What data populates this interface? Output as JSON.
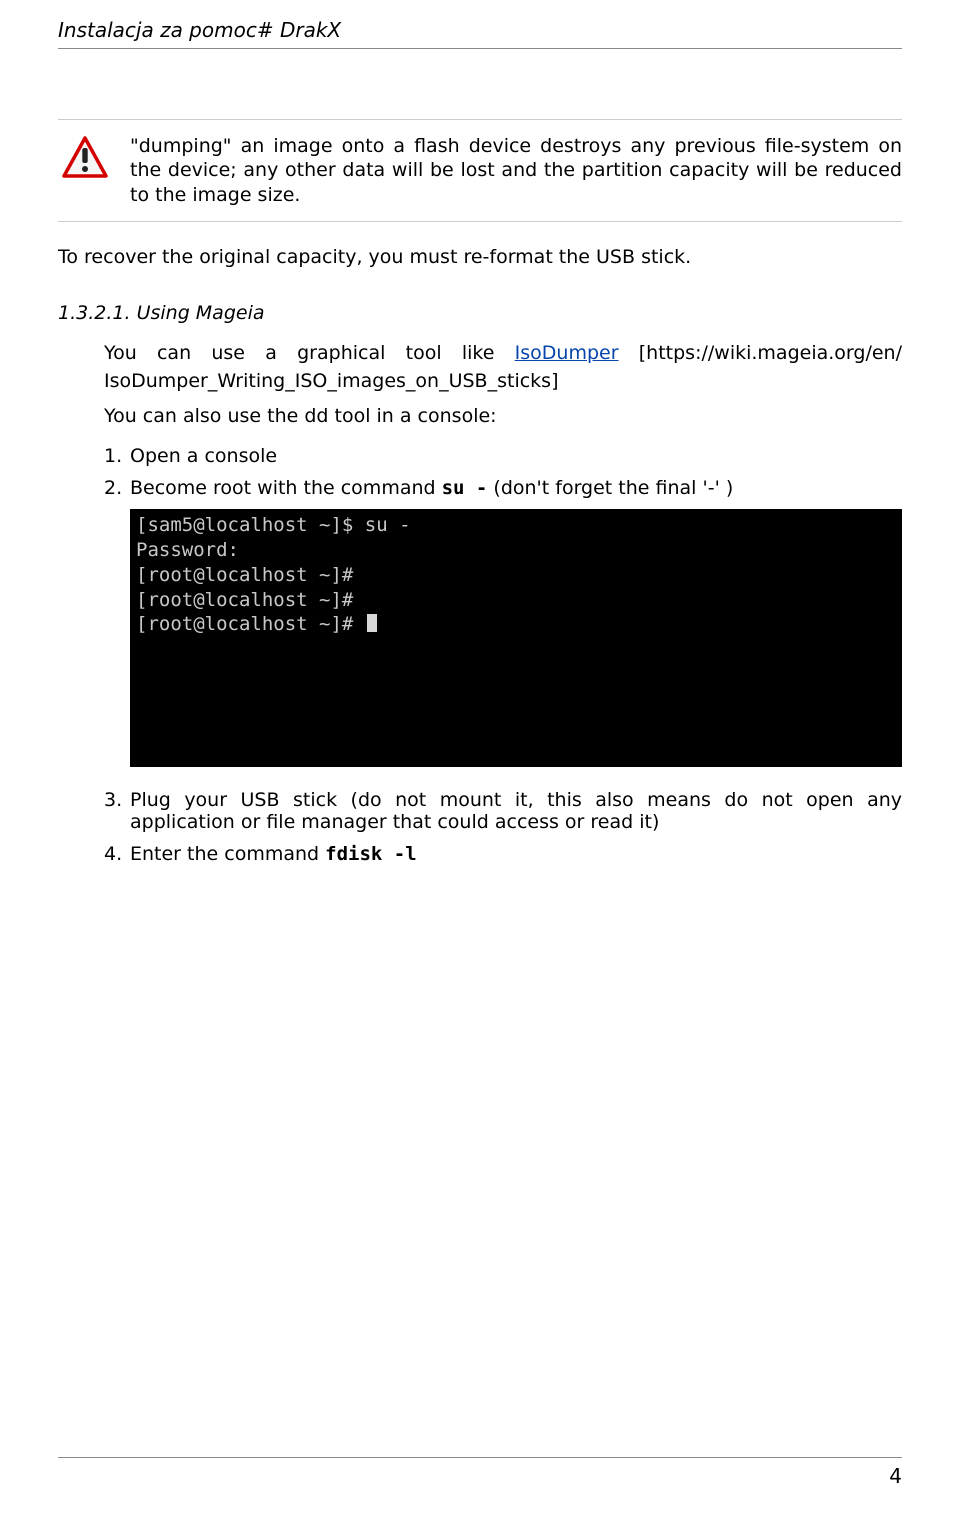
{
  "header": {
    "title": "Instalacja za pomoc# DrakX"
  },
  "warning": {
    "text": "\"dumping\" an image onto a flash device destroys any previous file-system on the device; any other data will be lost and the partition capacity will be reduced to the image size."
  },
  "recover": "To recover the original capacity, you must re-format the USB stick.",
  "section": {
    "num": "1.3.2.1.",
    "title": "Using Mageia"
  },
  "graphical": {
    "part1a": "You",
    "part1b": "can",
    "part1c": "use",
    "part1d": "a",
    "part1e": "graphical",
    "part1f": "tool",
    "part1g": "like",
    "linktext": "IsoDumper",
    "url_prefix": "[https://wiki.mageia.org/en/",
    "line2": "IsoDumper_Writing_ISO_images_on_USB_sticks]"
  },
  "ddline": "You can also use the dd tool in a console:",
  "steps_a": [
    {
      "n": "1.",
      "text": "Open a console"
    },
    {
      "n": "2.",
      "prefix": "Become root with the command ",
      "cmd": "su -",
      "suffix": " (don't forget the final '-' )"
    }
  ],
  "terminal": {
    "l1": "[sam5@localhost ~]$ su -",
    "l2": "Password:",
    "l3": "[root@localhost ~]#",
    "l4": "[root@localhost ~]#",
    "l5": "[root@localhost ~]# "
  },
  "steps_b": [
    {
      "n": "3.",
      "text": "Plug your USB stick (do not mount it, this also means do not open any application or file manager that could access or read it)"
    },
    {
      "n": "4.",
      "prefix": "Enter the command ",
      "cmd": "fdisk -l"
    }
  ],
  "footer": {
    "page": "4"
  }
}
